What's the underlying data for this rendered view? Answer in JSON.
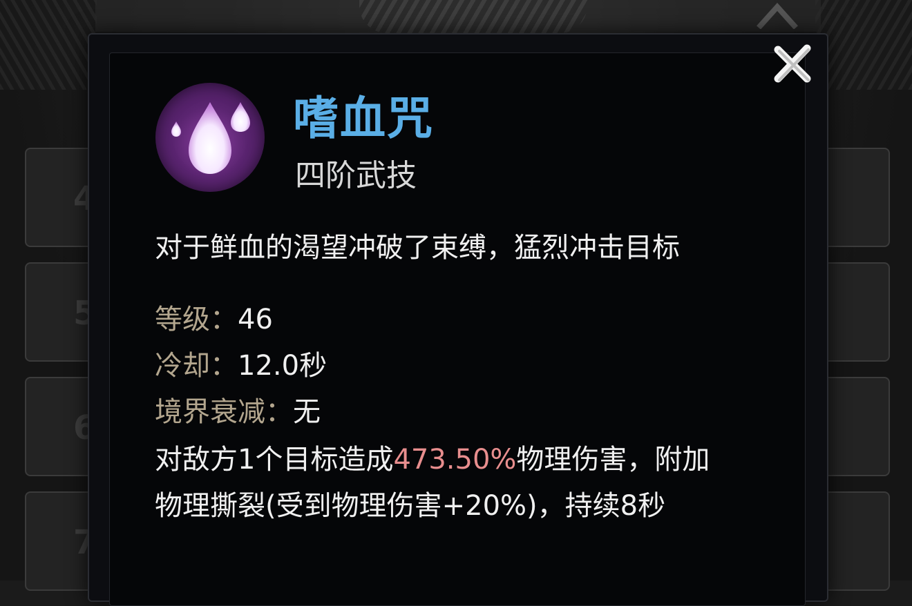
{
  "colors": {
    "title": "#5aaee6",
    "stat_key": "#b3a68e",
    "value": "#f0f0f0",
    "highlight": "#e88e8e",
    "icon_bg": "#5a2470"
  },
  "background": {
    "slot_numbers": [
      "4",
      "5",
      "6",
      "7"
    ]
  },
  "skill": {
    "icon": "blood-drops-icon",
    "name": "嗜血咒",
    "tier": "四阶武技",
    "description": "对于鲜血的渴望冲破了束缚，猛烈冲击目标"
  },
  "stats": {
    "level_label": "等级：",
    "level_value": "46",
    "cooldown_label": "冷却：",
    "cooldown_value": "12.0秒",
    "decay_label": "境界衰减：",
    "decay_value": "无"
  },
  "effect": {
    "line1_prefix": "对敌方1个目标造成",
    "line1_damage": "473.50%",
    "line1_suffix": "物理伤害，附加",
    "line2": "物理撕裂(受到物理伤害+20%)，持续8秒"
  }
}
